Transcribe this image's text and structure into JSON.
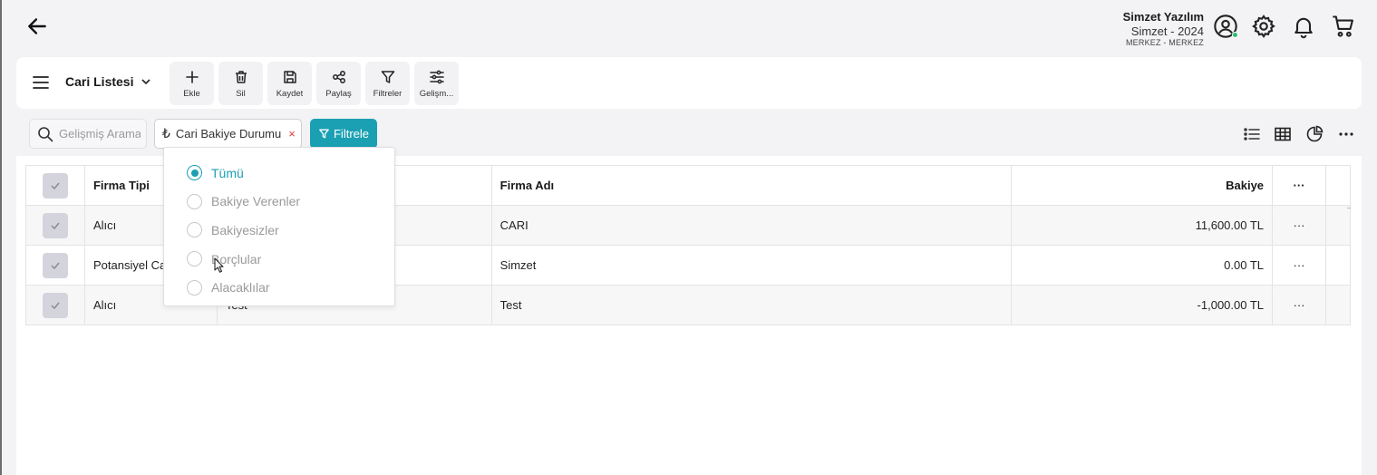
{
  "header": {
    "company_name": "Simzet Yazılım",
    "company_year": "Simzet - 2024",
    "branch": "MERKEZ - MERKEZ",
    "status_color": "#2bbd6e"
  },
  "toolbar": {
    "title": "Cari Listesi",
    "buttons": [
      {
        "label": "Ekle",
        "icon": "plus-icon"
      },
      {
        "label": "Sil",
        "icon": "trash-icon"
      },
      {
        "label": "Kaydet",
        "icon": "save-icon"
      },
      {
        "label": "Paylaş",
        "icon": "share-icon"
      },
      {
        "label": "Filtreler",
        "icon": "filter-icon"
      },
      {
        "label": "Gelişm...",
        "icon": "sliders-icon"
      }
    ]
  },
  "filters": {
    "search_placeholder": "Gelişmiş Arama",
    "chip_label": "Cari Bakiye Durumu",
    "chip_remove": "×",
    "filter_button": "Filtrele",
    "accent_color": "#1aa0b2"
  },
  "table": {
    "columns": [
      "Firma Tipi",
      "",
      "Firma Adı",
      "Bakiye"
    ],
    "more_label": "···",
    "rows": [
      {
        "type": "Alıcı",
        "col2": "",
        "name": "CARI",
        "balance": "11,600.00 TL"
      },
      {
        "type": "Potansiyel Ca",
        "col2": "",
        "name": "Simzet",
        "balance": "0.00 TL"
      },
      {
        "type": "Alıcı",
        "col2": "Test",
        "name": "Test",
        "balance": "-1,000.00 TL"
      }
    ]
  },
  "dropdown": {
    "options": [
      {
        "label": "Tümü",
        "selected": true
      },
      {
        "label": "Bakiye Verenler",
        "selected": false
      },
      {
        "label": "Bakiyesizler",
        "selected": false
      },
      {
        "label": "Borçlular",
        "selected": false
      },
      {
        "label": "Alacaklılar",
        "selected": false
      }
    ]
  }
}
